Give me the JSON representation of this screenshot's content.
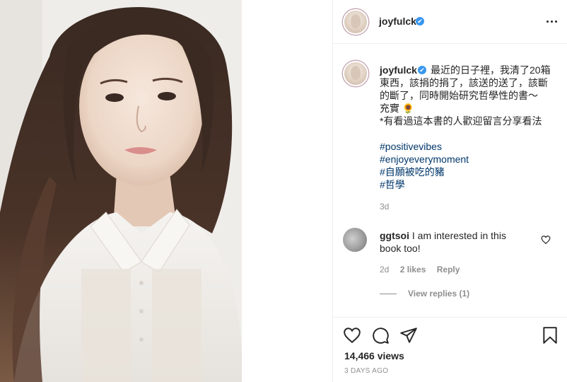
{
  "post": {
    "username": "joyfulck",
    "verified_mark": "✔",
    "more_icon": "more-options-icon",
    "caption": {
      "username": "joyfulck",
      "lines": [
        "最近的日子裡，我清了20箱",
        "東西，該捐的捐了，該送的送了，該斷",
        "的斷了，同時開始研究哲學性的書～",
        "充實 🌻",
        "*有看過這本書的人歡迎留言分享看法"
      ],
      "hashtags": [
        "#positivevibes",
        "#enjoyeverymoment",
        "#自願被吃的豬",
        "#哲學"
      ],
      "age": "3d"
    },
    "comment": {
      "username": "ggtsoi",
      "text_line1": "I am interested in this",
      "text_line2": "book too!",
      "age": "2d",
      "likes": "2 likes",
      "reply": "Reply",
      "view_replies": "View replies (1)"
    },
    "views": "14,466 views",
    "time_ago": "3 DAYS AGO"
  },
  "colors": {
    "text": "#262626",
    "muted": "#8e8e8e",
    "hashtag": "#00376b",
    "verified": "#3897f0",
    "border": "#efefef"
  },
  "icons": [
    "heart-icon",
    "comment-icon",
    "share-icon",
    "bookmark-icon",
    "like-comment-icon"
  ]
}
